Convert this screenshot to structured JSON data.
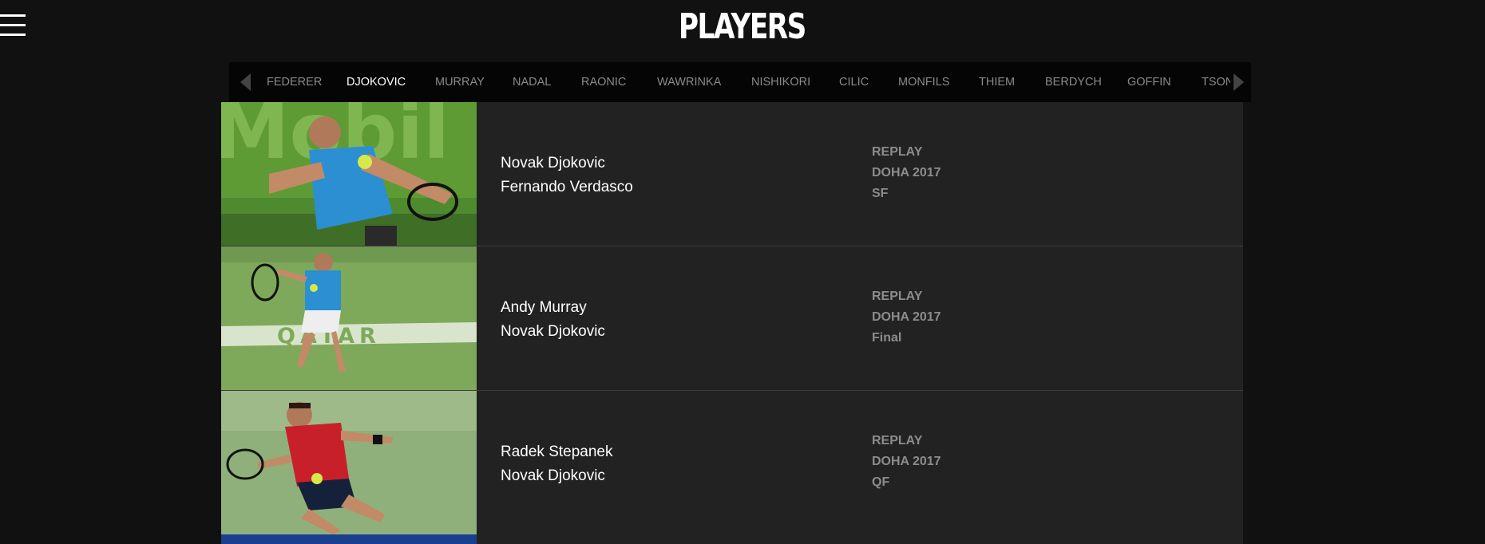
{
  "header": {
    "title": "PLAYERS",
    "menu_icon": "hamburger-menu-icon"
  },
  "player_nav": {
    "prev_icon": "chevron-left-icon",
    "next_icon": "chevron-right-icon",
    "active": "DJOKOVIC",
    "items": [
      "FEDERER",
      "DJOKOVIC",
      "MURRAY",
      "NADAL",
      "RAONIC",
      "WAWRINKA",
      "NISHIKORI",
      "CILIC",
      "MONFILS",
      "THIEM",
      "BERDYCH",
      "GOFFIN",
      "TSON"
    ]
  },
  "matches": [
    {
      "player1": "Novak Djokovic",
      "player2": "Fernando Verdasco",
      "type": "REPLAY",
      "event": "DOHA  2017",
      "round": "SF"
    },
    {
      "player1": "Andy Murray",
      "player2": "Novak Djokovic",
      "type": "REPLAY",
      "event": "DOHA  2017",
      "round": "Final"
    },
    {
      "player1": "Radek Stepanek",
      "player2": "Novak Djokovic",
      "type": "REPLAY",
      "event": "DOHA  2017",
      "round": "QF"
    }
  ],
  "thumb_texts": {
    "banner1": "Mobil",
    "banner2": "QATAR"
  },
  "colors": {
    "background": "#111111",
    "row_background": "#222222",
    "nav_background": "#050505",
    "text_primary": "#ffffff",
    "text_secondary": "#8c8c8c"
  }
}
